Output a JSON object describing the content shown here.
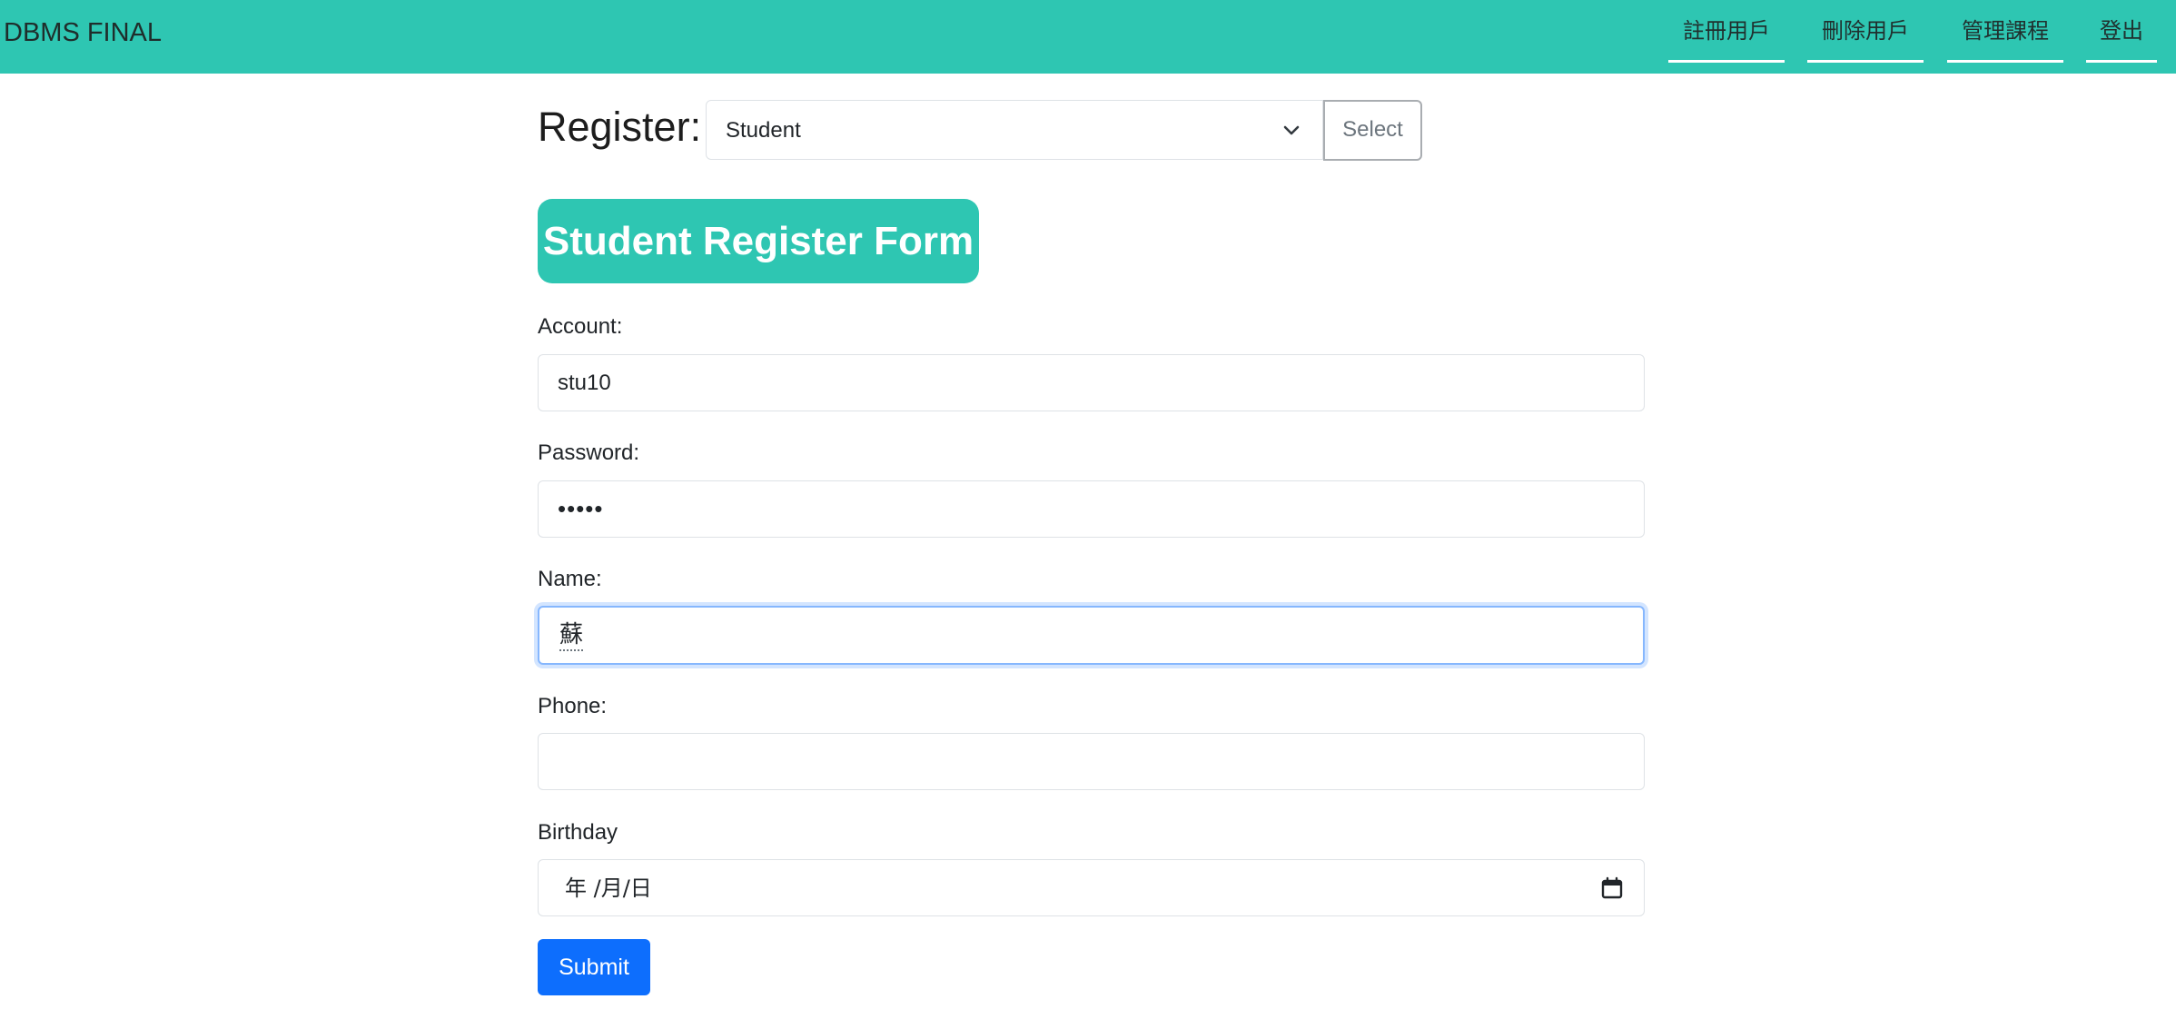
{
  "navbar": {
    "brand": "DBMS FINAL",
    "links": [
      "註冊用戶",
      "刪除用戶",
      "管理課程",
      "登出"
    ]
  },
  "register": {
    "title": "Register:",
    "selected_role": "Student",
    "select_button": "Select"
  },
  "form": {
    "heading": "Student Register Form",
    "account_label": "Account:",
    "account_value": "stu10",
    "password_label": "Password:",
    "password_value": "•••••",
    "name_label": "Name:",
    "name_value": "蘇",
    "phone_label": "Phone:",
    "phone_value": "",
    "birthday_label": "Birthday",
    "birthday_placeholder": "年 /月/日",
    "submit_label": "Submit"
  },
  "colors": {
    "accent": "#2ec6b2",
    "primary_button": "#0d6efd",
    "focus_border": "#86b7fe"
  },
  "icons": {
    "select_dropdown": "chevron-down-icon",
    "birthday_picker": "calendar-icon"
  }
}
